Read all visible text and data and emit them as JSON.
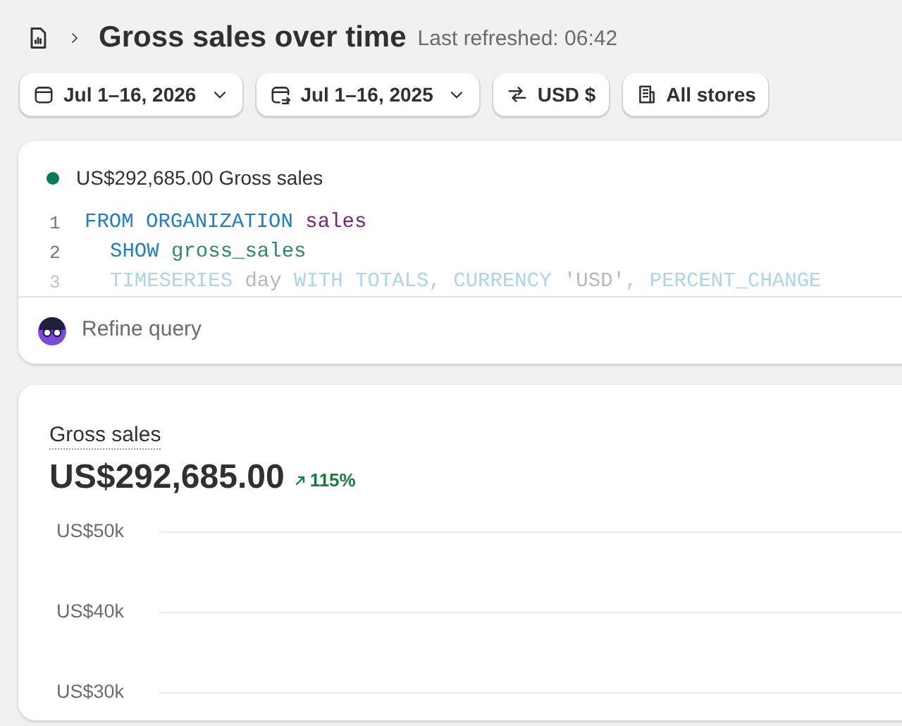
{
  "header": {
    "title": "Gross sales over time",
    "refreshed": "Last refreshed: 06:42"
  },
  "filters": [
    {
      "kind": "calendar",
      "label": "Jul 1–16, 2026",
      "dropdown": true
    },
    {
      "kind": "compare",
      "label": "Jul 1–16, 2025",
      "dropdown": true
    },
    {
      "kind": "currency",
      "label": "USD $",
      "dropdown": false
    },
    {
      "kind": "stores",
      "label": "All stores",
      "dropdown": false
    }
  ],
  "query_card": {
    "series": {
      "label": "US$292,685.00 Gross sales",
      "color": "#0b7a5a"
    },
    "lines": [
      {
        "number": "1",
        "faded": false,
        "indent": false,
        "tokens": [
          {
            "kind": "keyword",
            "text": "FROM ORGANIZATION"
          },
          {
            "kind": "name",
            "text": "sales"
          }
        ]
      },
      {
        "number": "2",
        "faded": false,
        "indent": true,
        "tokens": [
          {
            "kind": "keyword",
            "text": "SHOW"
          },
          {
            "kind": "field",
            "text": "gross_sales"
          }
        ]
      },
      {
        "number": "3",
        "faded": true,
        "indent": true,
        "tokens": [
          {
            "kind": "keyword",
            "text": "TIMESERIES"
          },
          {
            "kind": "plain",
            "text": "day"
          },
          {
            "kind": "keyword",
            "text": "WITH TOTALS"
          },
          {
            "kind": "punct",
            "text": ","
          },
          {
            "kind": "keyword",
            "text": "CURRENCY"
          },
          {
            "kind": "plain",
            "text": "'USD'"
          },
          {
            "kind": "punct",
            "text": ","
          },
          {
            "kind": "keyword",
            "text": "PERCENT_CHANGE"
          }
        ]
      }
    ],
    "refine": "Refine query"
  },
  "metric_card": {
    "title": "Gross sales",
    "value": "US$292,685.00",
    "change": "115%",
    "y_labels": [
      "US$50k",
      "US$40k",
      "US$30k"
    ]
  }
}
